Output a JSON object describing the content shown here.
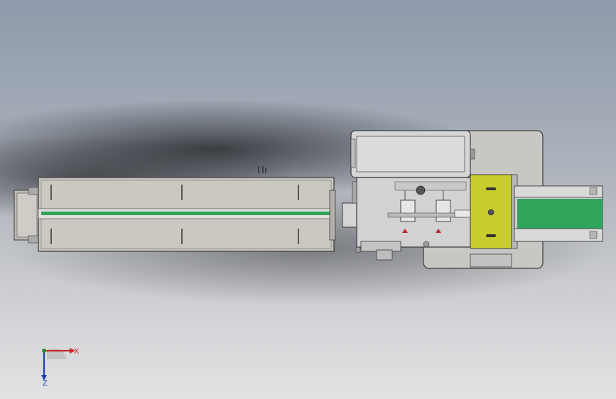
{
  "viewport": {
    "name": "3d-cad-viewport"
  },
  "colors": {
    "frame": "#c6c3bd",
    "frame_dark": "#9e9b96",
    "belt_green": "#2fa45a",
    "yellow_plate": "#c9cc2e",
    "outline": "#3a3a3a",
    "panel_light": "#d9d9d9",
    "red_part": "#c0282d"
  },
  "triad": {
    "x_label": "X",
    "z_label": "Z",
    "x_color": "#c62828",
    "y_color": "#2e8b2e",
    "z_color": "#1f3fb0"
  }
}
